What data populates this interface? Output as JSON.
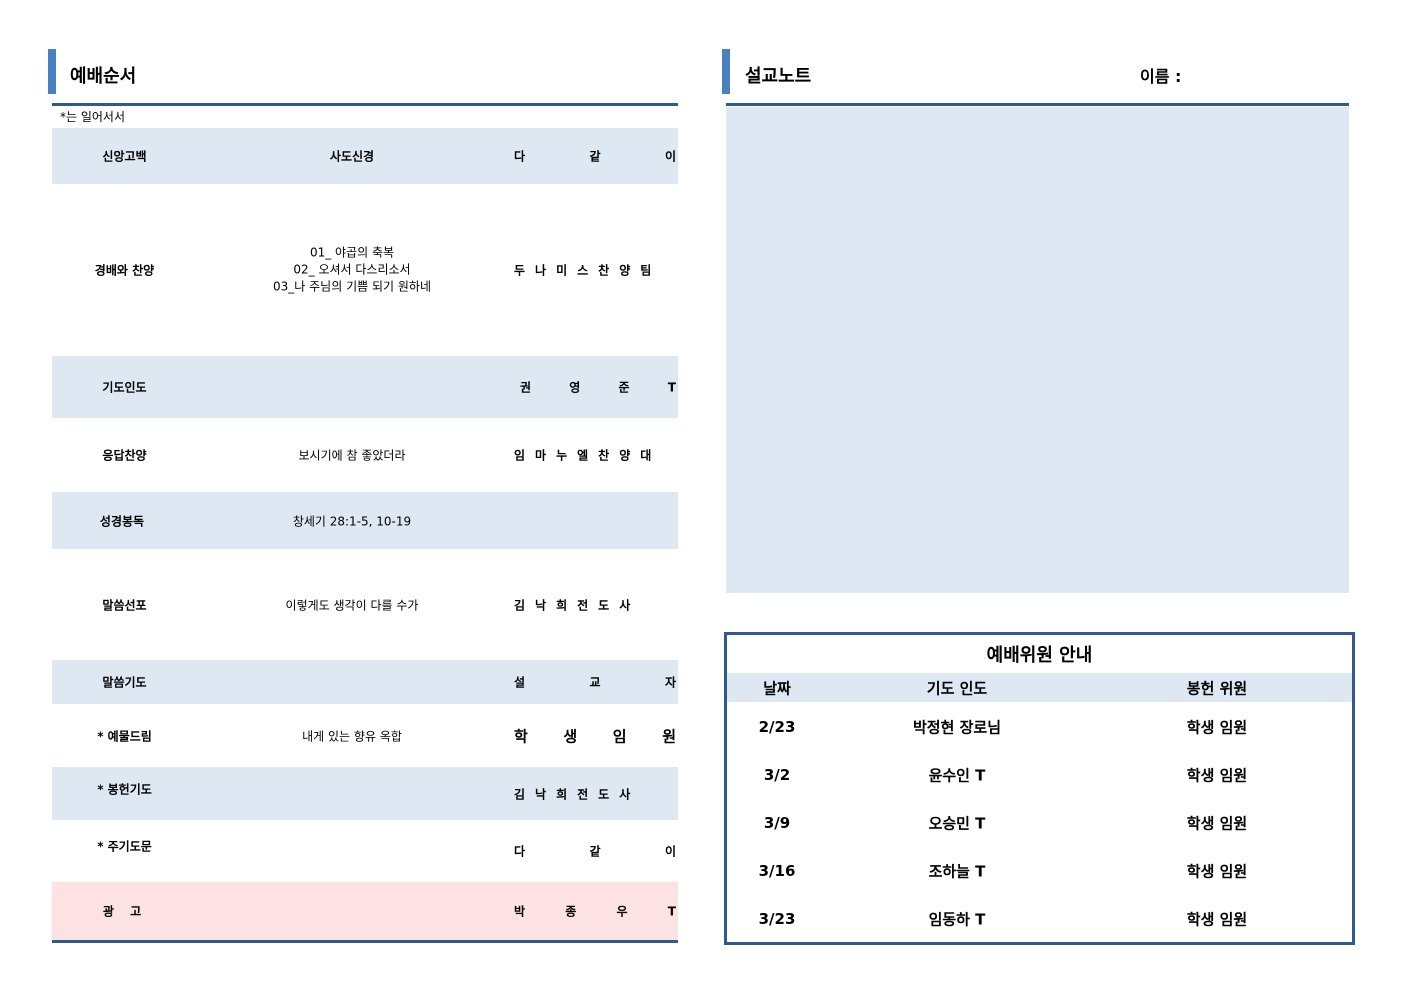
{
  "left": {
    "title": "예배순서",
    "note": "*는 일어서서",
    "rows": [
      {
        "item": "신앙고백",
        "content": "사도신경",
        "leader": "다 같 이"
      },
      {
        "item": "경배와 찬양",
        "content_lines": [
          "01_ 야곱의 축복",
          "02_ 오셔서 다스리소서",
          "03_나 주님의 기쁨 되기 원하네"
        ],
        "leader": "두나미스찬양팀"
      },
      {
        "item": "기도인도",
        "content": "",
        "leader": "권 영 준 T"
      },
      {
        "item": "응답찬양",
        "content": "보시기에 참 좋았더라",
        "leader": "임마누엘찬양대"
      },
      {
        "item": "성경봉독",
        "content": "창세기 28:1-5, 10-19",
        "leader": ""
      },
      {
        "item": "말씀선포",
        "content": "이렇게도 생각이 다를 수가",
        "leader": "김낙희전도사"
      },
      {
        "item": "말씀기도",
        "content": "",
        "leader": "설 교 자"
      },
      {
        "item": "* 예물드림",
        "content": "내게 있는 향유 옥합",
        "leader": "학 생 임 원"
      },
      {
        "item": "* 봉헌기도",
        "content": "",
        "leader": "김낙희전도사"
      },
      {
        "item": "* 주기도문",
        "content": "",
        "leader": "다 같 이"
      },
      {
        "item": "광 고",
        "content": "",
        "leader": "박 종 우 T"
      }
    ]
  },
  "right": {
    "title": "설교노트",
    "name_label": "이름 :",
    "committee": {
      "title": "예배위원 안내",
      "headers": [
        "날짜",
        "기도 인도",
        "봉헌 위원"
      ],
      "rows": [
        [
          "2/23",
          "박정현 장로님",
          "학생 임원"
        ],
        [
          "3/2",
          "윤수인 T",
          "학생 임원"
        ],
        [
          "3/9",
          "오승민 T",
          "학생 임원"
        ],
        [
          "3/16",
          "조하늘 T",
          "학생 임원"
        ],
        [
          "3/23",
          "임동하 T",
          "학생 임원"
        ]
      ]
    }
  },
  "colors": {
    "accent": "#4a7fc1",
    "rule": "#2f5b8c",
    "row_blue": "#dee8f3",
    "row_pink": "#fde2e4"
  }
}
